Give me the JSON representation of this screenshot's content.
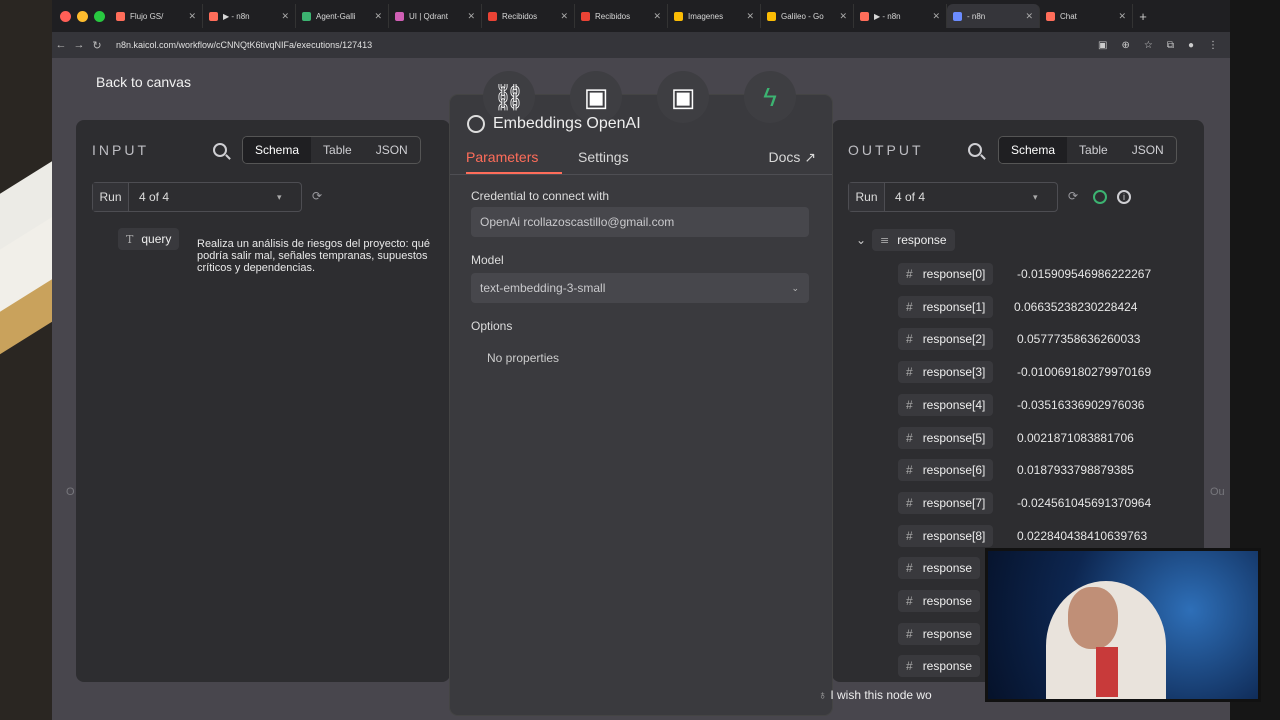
{
  "tabs": [
    {
      "label": "Flujo GS/",
      "color": "#ff6d5a"
    },
    {
      "label": "▶ - n8n",
      "color": "#ff6d5a"
    },
    {
      "label": "Agent-Galli",
      "color": "#3cb371"
    },
    {
      "label": "UI | Qdrant",
      "color": "#d05fb5"
    },
    {
      "label": "Recibidos",
      "color": "#ea4335"
    },
    {
      "label": "Recibidos",
      "color": "#ea4335"
    },
    {
      "label": "Imagenes",
      "color": "#fbbc04"
    },
    {
      "label": "Galileo - Go",
      "color": "#fbbc04"
    },
    {
      "label": "▶ - n8n",
      "color": "#ff6d5a"
    },
    {
      "label": "- n8n",
      "color": "#6b8cff",
      "active": true
    },
    {
      "label": "Chat",
      "color": "#ff6d5a"
    }
  ],
  "url": "n8n.kaicol.com/workflow/cCNNQtK6tivqNIFa/executions/127413",
  "back_label": "Back to canvas",
  "input": {
    "title": "INPUT",
    "views": [
      "Schema",
      "Table",
      "JSON"
    ],
    "run_label": "Run",
    "run_value": "4 of 4",
    "field_name": "query",
    "field_value": "Realiza un análisis de riesgos del proyecto: qué podría salir mal, señales tempranas, supuestos críticos y dependencias."
  },
  "node": {
    "title": "Embeddings OpenAI",
    "tab_parameters": "Parameters",
    "tab_settings": "Settings",
    "docs": "Docs",
    "credential_label": "Credential to connect with",
    "credential_value": "OpenAi rcollazoscastillo@gmail.com",
    "model_label": "Model",
    "model_value": "text-embedding-3-small",
    "options_label": "Options",
    "no_properties": "No properties"
  },
  "output": {
    "title": "OUTPUT",
    "views": [
      "Schema",
      "Table",
      "JSON"
    ],
    "run_label": "Run",
    "run_value": "4 of 4",
    "root": "response",
    "rows": [
      {
        "k": "response[0]",
        "v": "-0.015909546986222267"
      },
      {
        "k": "response[1]",
        "v": "0.06635238230228424"
      },
      {
        "k": "response[2]",
        "v": "0.05777358636260033"
      },
      {
        "k": "response[3]",
        "v": "-0.010069180279970169"
      },
      {
        "k": "response[4]",
        "v": "-0.03516336902976036"
      },
      {
        "k": "response[5]",
        "v": "0.0021871083881706"
      },
      {
        "k": "response[6]",
        "v": "0.0187933798879385"
      },
      {
        "k": "response[7]",
        "v": "-0.024561045691370964"
      },
      {
        "k": "response[8]",
        "v": "0.022840438410639763"
      },
      {
        "k": "response",
        "v": ""
      },
      {
        "k": "response",
        "v": ""
      },
      {
        "k": "response",
        "v": ""
      },
      {
        "k": "response",
        "v": ""
      }
    ]
  },
  "footer_note": "I wish this node wo"
}
